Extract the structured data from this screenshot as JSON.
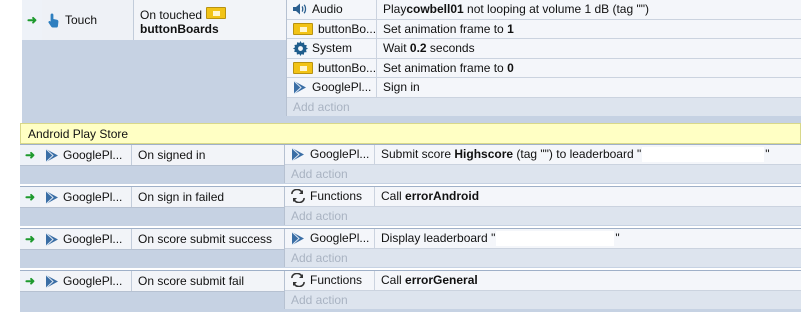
{
  "events": [
    {
      "condition": {
        "object": "Touch",
        "object_icon": "touch-hand-icon",
        "text": "On touched",
        "text_icon": "button-boards-sprite-icon",
        "text_bold": "buttonBoards"
      },
      "actions": [
        {
          "object": "Audio",
          "icon": "audio-speaker-icon",
          "pre": "Play ",
          "bold": "cowbell01",
          "post": " not looping at volume 1 dB (tag \"\")"
        },
        {
          "object": "buttonBo...",
          "icon": "button-boards-sprite-icon",
          "pre": "Set animation frame to ",
          "bold": "1",
          "post": ""
        },
        {
          "object": "System",
          "icon": "gear-icon",
          "pre": "Wait ",
          "bold": "0.2",
          "post": " seconds"
        },
        {
          "object": "buttonBo...",
          "icon": "button-boards-sprite-icon",
          "pre": "Set animation frame to ",
          "bold": "0",
          "post": ""
        },
        {
          "object": "GooglePl...",
          "icon": "google-play-icon",
          "pre": "Sign in",
          "bold": "",
          "post": ""
        }
      ],
      "add_action": "Add action"
    },
    {
      "condition": {
        "object": "GooglePl...",
        "object_icon": "google-play-icon",
        "text": "On signed in"
      },
      "actions": [
        {
          "object": "GooglePl...",
          "icon": "google-play-icon",
          "pre": "Submit score ",
          "bold": "Highscore",
          "post": " (tag \"\") to leaderboard \"",
          "tail": "\""
        }
      ],
      "add_action": "Add action"
    },
    {
      "condition": {
        "object": "GooglePl...",
        "object_icon": "google-play-icon",
        "text": "On sign in failed"
      },
      "actions": [
        {
          "object": "Functions",
          "icon": "functions-arrows-icon",
          "pre": "Call ",
          "bold": "errorAndroid",
          "post": ""
        }
      ],
      "add_action": "Add action"
    },
    {
      "condition": {
        "object": "GooglePl...",
        "object_icon": "google-play-icon",
        "text": "On score submit success"
      },
      "actions": [
        {
          "object": "GooglePl...",
          "icon": "google-play-icon",
          "pre": "Display leaderboard \"",
          "bold": "",
          "post": "",
          "tail": "\""
        }
      ],
      "add_action": "Add action"
    },
    {
      "condition": {
        "object": "GooglePl...",
        "object_icon": "google-play-icon",
        "text": "On score submit fail"
      },
      "actions": [
        {
          "object": "Functions",
          "icon": "functions-arrows-icon",
          "pre": "Call ",
          "bold": "errorGeneral",
          "post": ""
        }
      ],
      "add_action": "Add action"
    }
  ],
  "comment": "Android Play Store",
  "colors": {
    "arrow": "#1e9a2e",
    "comment_bg": "#ffffc4",
    "event_bg": "#c6d2e3",
    "google_play": "#3a6ea5"
  }
}
